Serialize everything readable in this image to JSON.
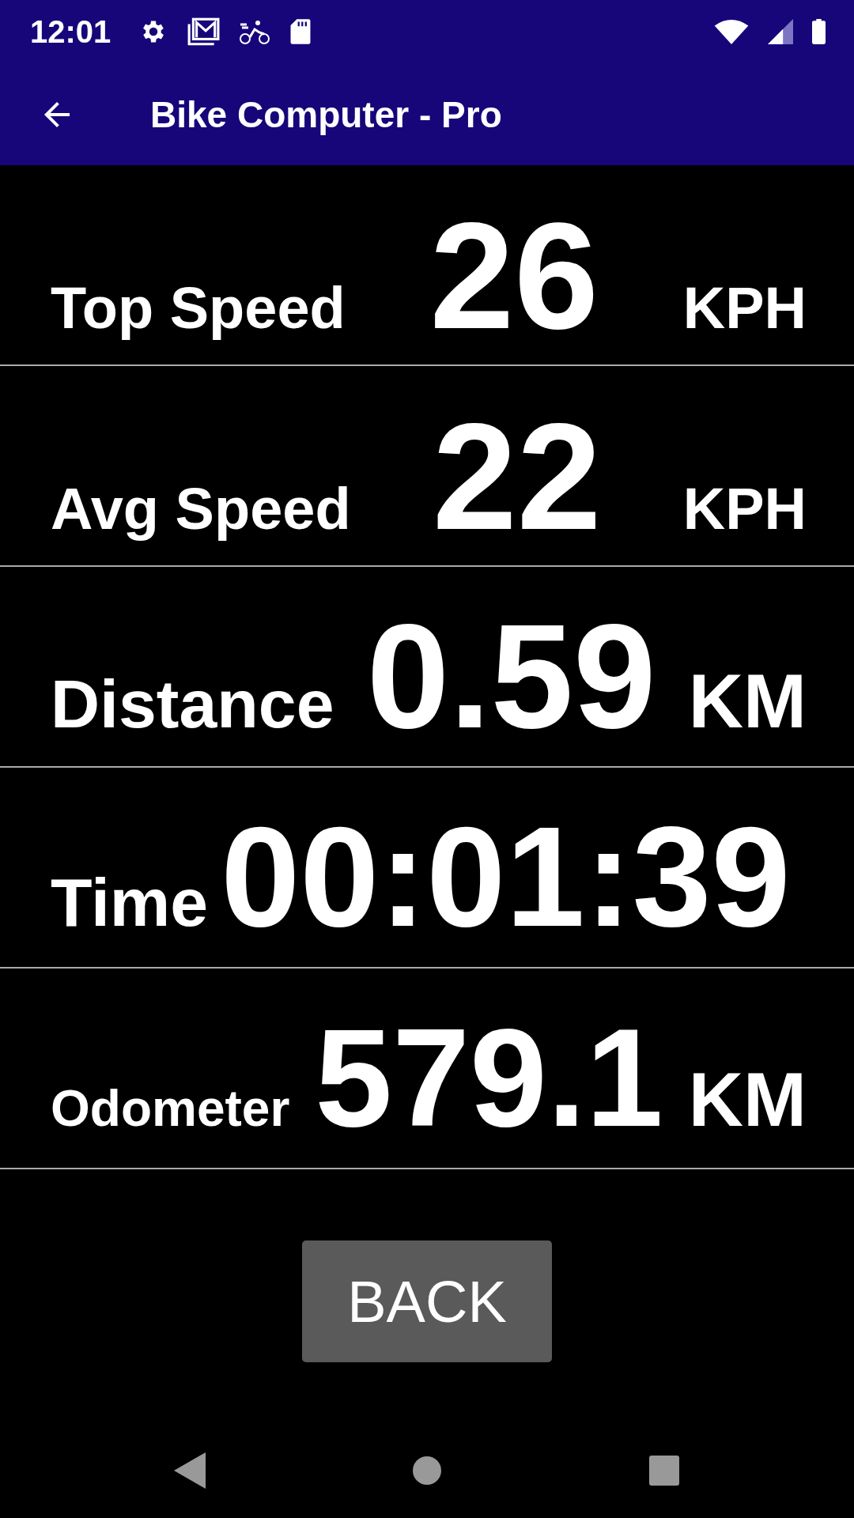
{
  "status_bar": {
    "time": "12:01"
  },
  "app_bar": {
    "title": "Bike Computer - Pro"
  },
  "stats": [
    {
      "label": "Top Speed",
      "value": "26",
      "unit": "KPH"
    },
    {
      "label": "Avg Speed",
      "value": "22",
      "unit": "KPH"
    },
    {
      "label": "Distance",
      "value": "0.59",
      "unit": "KM"
    },
    {
      "label": "Time",
      "value": "00:01:39"
    },
    {
      "label": "Odometer",
      "value": "579.1",
      "unit": "KM"
    }
  ],
  "back_button": {
    "label": "BACK"
  }
}
